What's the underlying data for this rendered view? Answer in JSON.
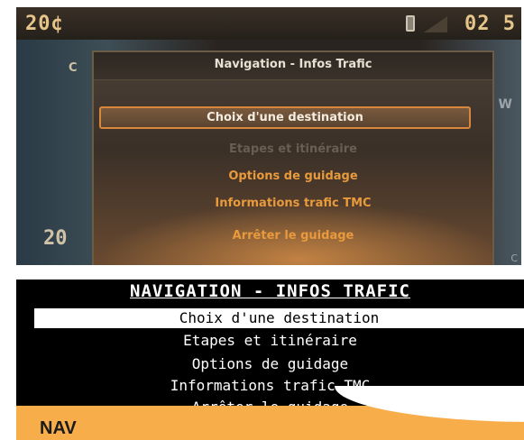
{
  "color_screen": {
    "status_left": "20¢",
    "status_right": "02 5",
    "side_left_value": "20",
    "side_c_label": "C",
    "menu": {
      "title": "Navigation - Infos Trafic",
      "items": [
        {
          "label": "Choix d'une destination",
          "state": "selected"
        },
        {
          "label": "Etapes et itinéraire",
          "state": "dim"
        },
        {
          "label": "Options de guidage",
          "state": "orange"
        },
        {
          "label": "Informations trafic TMC",
          "state": "orange"
        },
        {
          "label": "Arrêter le guidage",
          "state": "orange"
        }
      ]
    },
    "right_mark": "W",
    "right_bottom": "C"
  },
  "mono_screen": {
    "title": "NAVIGATION - INFOS TRAFIC",
    "items": [
      {
        "label": "Choix d'une destination",
        "selected": true
      },
      {
        "label": "Etapes et itinéraire",
        "selected": false
      },
      {
        "label": "Options de guidage",
        "selected": false
      },
      {
        "label": "Informations trafic TMC",
        "selected": false
      },
      {
        "label": "Arrêter le guidage",
        "selected": false
      }
    ]
  },
  "footer": {
    "label": "NAV",
    "color": "#f6ad4a"
  },
  "icons": [
    "phone-icon",
    "signal-icon"
  ]
}
